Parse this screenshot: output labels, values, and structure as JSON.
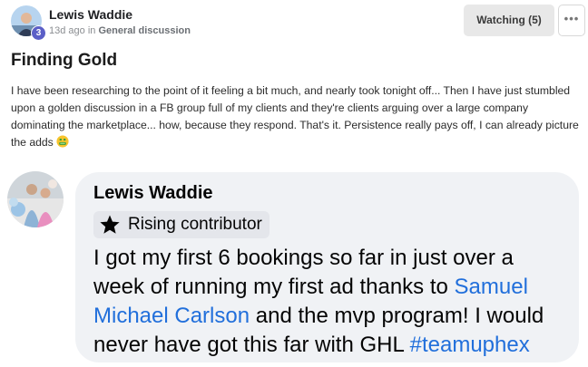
{
  "post": {
    "author": "Lewis Waddie",
    "level": "3",
    "time": "13d ago in",
    "category": "General discussion",
    "watch_label": "Watching (5)",
    "more_label": "•••",
    "title": "Finding Gold",
    "body": "I have been researching to the point of it feeling a bit much, and nearly took tonight off... Then I have just stumbled upon a golden discussion in a FB group full of my clients and they're clients arguing over a large company dominating the marketplace... how, because they respond. That's it. Persistence really pays off, I can already picture the adds",
    "emoji": "money-mouth-face-icon"
  },
  "comment": {
    "author": "Lewis Waddie",
    "badge": "Rising contributor",
    "text_1": "I got my first 6 bookings so far in just over a week of running my first ad thanks to ",
    "mention": "Samuel Michael Carlson",
    "text_2": " and the mvp program! I would never have got this far with GHL ",
    "hashtag": "#teamuphex"
  },
  "colors": {
    "accent_link": "#216fdb",
    "badge_level": "#5b5fc7",
    "bubble_bg": "#f0f2f5"
  }
}
